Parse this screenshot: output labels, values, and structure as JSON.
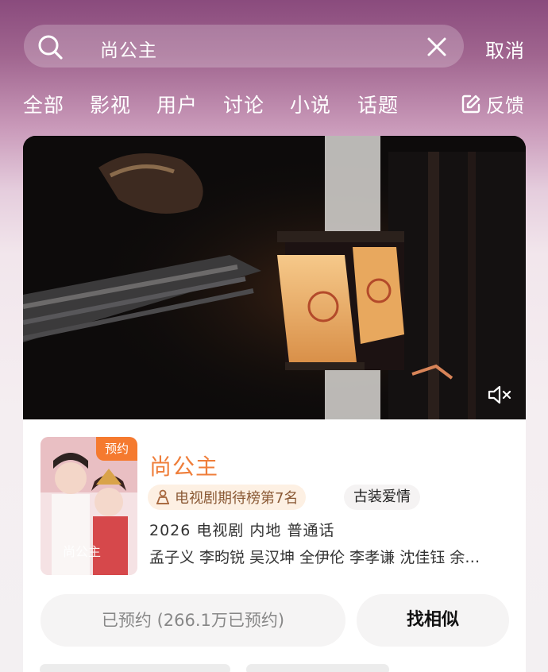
{
  "search": {
    "query": "尚公主",
    "cancel_label": "取消"
  },
  "tabs": [
    {
      "label": "全部"
    },
    {
      "label": "影视"
    },
    {
      "label": "用户"
    },
    {
      "label": "讨论"
    },
    {
      "label": "小说"
    },
    {
      "label": "话题"
    }
  ],
  "feedback_label": "反馈",
  "show": {
    "poster_badge": "预约",
    "title": "尚公主",
    "rank_tag": "电视剧期待榜第7名",
    "genre_tag": "古装爱情",
    "meta": "2026 电视剧 内地 普通话",
    "cast": "孟子义 李昀锐 吴汉坤 全伊伦 李孝谦 沈佳钰 余…",
    "reserved_button": "已预约 (266.1万已预约)",
    "similar_button": "找相似"
  },
  "colors": {
    "accent": "#ef7e3a",
    "badge": "#f57a2f",
    "header_gradient_top": "#8a4b7d"
  },
  "icons": {
    "search": "search-icon",
    "clear": "close-icon",
    "feedback": "edit-icon",
    "mute": "mute-icon",
    "rank": "ranking-icon"
  }
}
